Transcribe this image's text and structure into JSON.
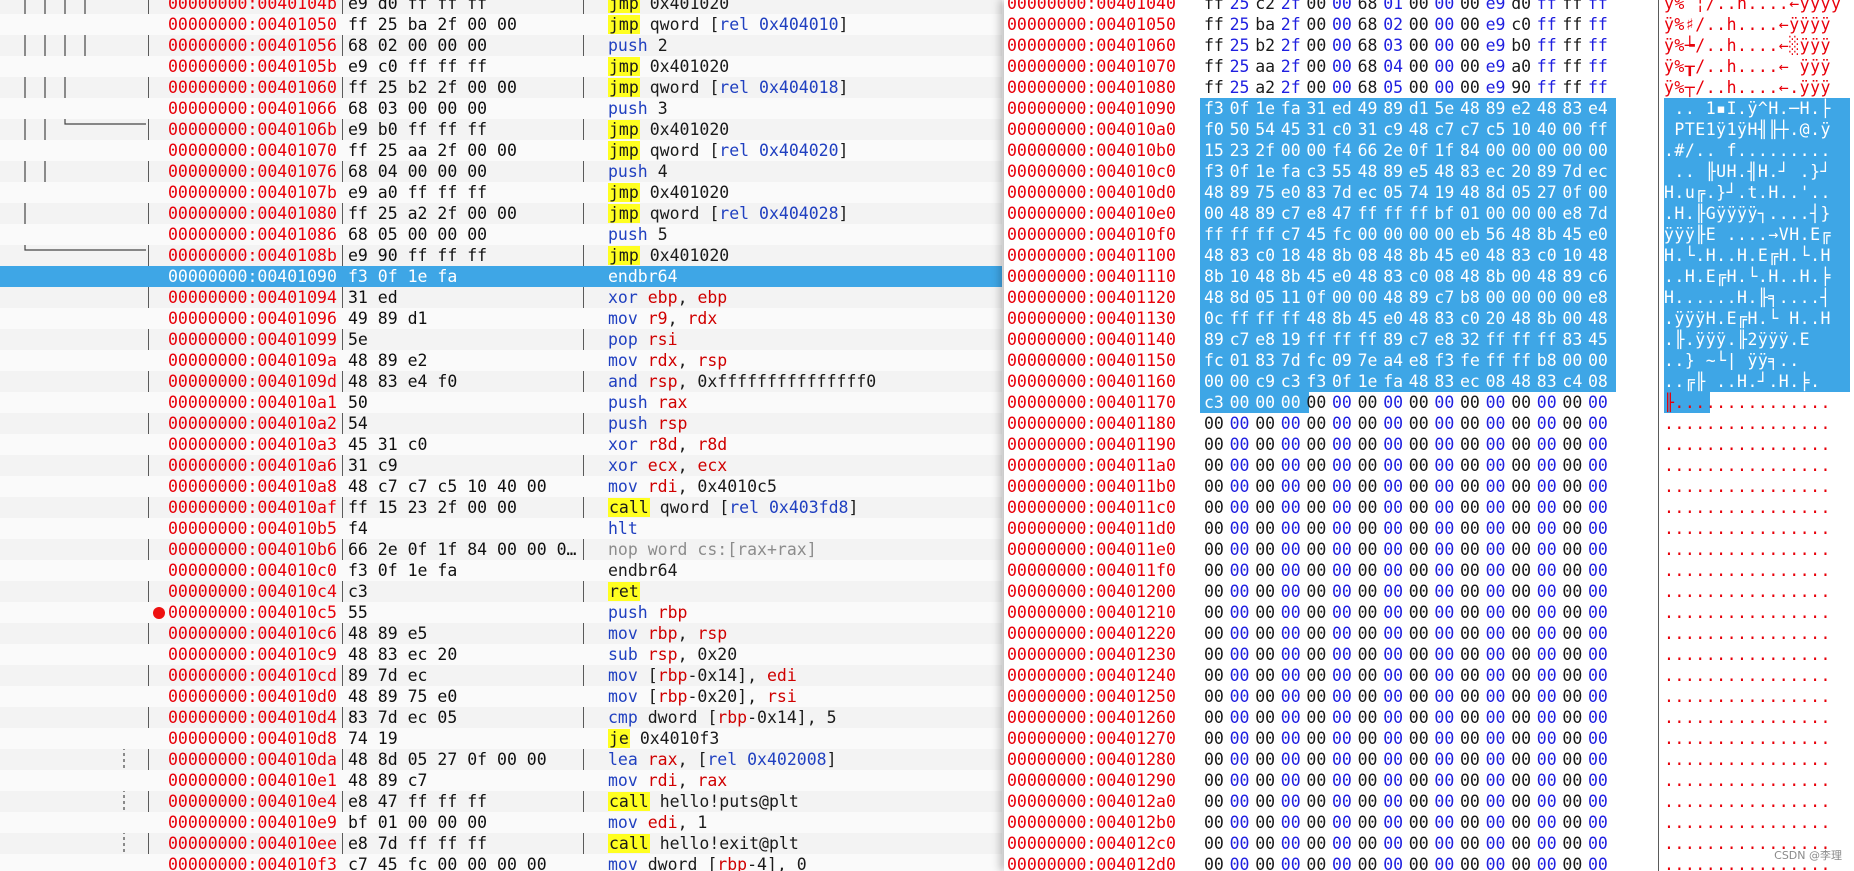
{
  "disassembly": {
    "rows": [
      {
        "addr": "00000000:0040104b",
        "bytes": "e9 d0 ff ff ff",
        "m": "jmp",
        "mk": "jmp",
        "ops": [
          [
            "0x401020",
            "txt"
          ]
        ]
      },
      {
        "addr": "00000000:00401050",
        "bytes": "ff 25 ba 2f 00 00",
        "m": "jmp",
        "mk": "jmp",
        "ops": [
          [
            "qword [",
            "txt"
          ],
          [
            "rel 0x404010",
            "mem"
          ],
          [
            "]",
            "txt"
          ]
        ]
      },
      {
        "addr": "00000000:00401056",
        "bytes": "68 02 00 00 00",
        "m": "push",
        "mk": "blue",
        "ops": [
          [
            "2",
            "txt"
          ]
        ]
      },
      {
        "addr": "00000000:0040105b",
        "bytes": "e9 c0 ff ff ff",
        "m": "jmp",
        "mk": "jmp",
        "ops": [
          [
            "0x401020",
            "txt"
          ]
        ]
      },
      {
        "addr": "00000000:00401060",
        "bytes": "ff 25 b2 2f 00 00",
        "m": "jmp",
        "mk": "jmp",
        "ops": [
          [
            "qword [",
            "txt"
          ],
          [
            "rel 0x404018",
            "mem"
          ],
          [
            "]",
            "txt"
          ]
        ]
      },
      {
        "addr": "00000000:00401066",
        "bytes": "68 03 00 00 00",
        "m": "push",
        "mk": "blue",
        "ops": [
          [
            "3",
            "txt"
          ]
        ]
      },
      {
        "addr": "00000000:0040106b",
        "bytes": "e9 b0 ff ff ff",
        "m": "jmp",
        "mk": "jmp",
        "ops": [
          [
            "0x401020",
            "txt"
          ]
        ]
      },
      {
        "addr": "00000000:00401070",
        "bytes": "ff 25 aa 2f 00 00",
        "m": "jmp",
        "mk": "jmp",
        "ops": [
          [
            "qword [",
            "txt"
          ],
          [
            "rel 0x404020",
            "mem"
          ],
          [
            "]",
            "txt"
          ]
        ]
      },
      {
        "addr": "00000000:00401076",
        "bytes": "68 04 00 00 00",
        "m": "push",
        "mk": "blue",
        "ops": [
          [
            "4",
            "txt"
          ]
        ]
      },
      {
        "addr": "00000000:0040107b",
        "bytes": "e9 a0 ff ff ff",
        "m": "jmp",
        "mk": "jmp",
        "ops": [
          [
            "0x401020",
            "txt"
          ]
        ]
      },
      {
        "addr": "00000000:00401080",
        "bytes": "ff 25 a2 2f 00 00",
        "m": "jmp",
        "mk": "jmp",
        "ops": [
          [
            "qword [",
            "txt"
          ],
          [
            "rel 0x404028",
            "mem"
          ],
          [
            "]",
            "txt"
          ]
        ]
      },
      {
        "addr": "00000000:00401086",
        "bytes": "68 05 00 00 00",
        "m": "push",
        "mk": "blue",
        "ops": [
          [
            "5",
            "txt"
          ]
        ]
      },
      {
        "addr": "00000000:0040108b",
        "bytes": "e9 90 ff ff ff",
        "m": "jmp",
        "mk": "jmp",
        "ops": [
          [
            "0x401020",
            "txt"
          ]
        ]
      },
      {
        "addr": "00000000:00401090",
        "bytes": "f3 0f 1e fa",
        "m": "endbr64",
        "mk": "plain",
        "ops": [],
        "selected": true
      },
      {
        "addr": "00000000:00401094",
        "bytes": "31 ed",
        "m": "xor",
        "mk": "blue",
        "ops": [
          [
            "ebp",
            "reg"
          ],
          [
            ", ",
            "txt"
          ],
          [
            "ebp",
            "reg"
          ]
        ]
      },
      {
        "addr": "00000000:00401096",
        "bytes": "49 89 d1",
        "m": "mov",
        "mk": "blue",
        "ops": [
          [
            "r9",
            "reg"
          ],
          [
            ", ",
            "txt"
          ],
          [
            "rdx",
            "reg"
          ]
        ]
      },
      {
        "addr": "00000000:00401099",
        "bytes": "5e",
        "m": "pop",
        "mk": "blue",
        "ops": [
          [
            "rsi",
            "reg"
          ]
        ]
      },
      {
        "addr": "00000000:0040109a",
        "bytes": "48 89 e2",
        "m": "mov",
        "mk": "blue",
        "ops": [
          [
            "rdx",
            "reg"
          ],
          [
            ", ",
            "txt"
          ],
          [
            "rsp",
            "reg"
          ]
        ]
      },
      {
        "addr": "00000000:0040109d",
        "bytes": "48 83 e4 f0",
        "m": "and",
        "mk": "blue",
        "ops": [
          [
            "rsp",
            "reg"
          ],
          [
            ", 0xfffffffffffffff0",
            "txt"
          ]
        ]
      },
      {
        "addr": "00000000:004010a1",
        "bytes": "50",
        "m": "push",
        "mk": "blue",
        "ops": [
          [
            "rax",
            "reg"
          ]
        ]
      },
      {
        "addr": "00000000:004010a2",
        "bytes": "54",
        "m": "push",
        "mk": "blue",
        "ops": [
          [
            "rsp",
            "reg"
          ]
        ]
      },
      {
        "addr": "00000000:004010a3",
        "bytes": "45 31 c0",
        "m": "xor",
        "mk": "blue",
        "ops": [
          [
            "r8d",
            "reg"
          ],
          [
            ", ",
            "txt"
          ],
          [
            "r8d",
            "reg"
          ]
        ]
      },
      {
        "addr": "00000000:004010a6",
        "bytes": "31 c9",
        "m": "xor",
        "mk": "blue",
        "ops": [
          [
            "ecx",
            "reg"
          ],
          [
            ", ",
            "txt"
          ],
          [
            "ecx",
            "reg"
          ]
        ]
      },
      {
        "addr": "00000000:004010a8",
        "bytes": "48 c7 c7 c5 10 40 00",
        "m": "mov",
        "mk": "blue",
        "ops": [
          [
            "rdi",
            "reg"
          ],
          [
            ", 0x4010c5",
            "txt"
          ]
        ]
      },
      {
        "addr": "00000000:004010af",
        "bytes": "ff 15 23 2f 00 00",
        "m": "call",
        "mk": "hl",
        "ops": [
          [
            "qword [",
            "txt"
          ],
          [
            "rel 0x403fd8",
            "mem"
          ],
          [
            "]",
            "txt"
          ]
        ]
      },
      {
        "addr": "00000000:004010b5",
        "bytes": "f4",
        "m": "hlt",
        "mk": "blue",
        "ops": []
      },
      {
        "addr": "00000000:004010b6",
        "bytes": "66 2e 0f 1f 84 00 00 0…",
        "m": "nop",
        "mk": "nop",
        "ops": [
          [
            "word cs:[rax+rax]",
            "nop"
          ]
        ]
      },
      {
        "addr": "00000000:004010c0",
        "bytes": "f3 0f 1e fa",
        "m": "endbr64",
        "mk": "plain",
        "ops": []
      },
      {
        "addr": "00000000:004010c4",
        "bytes": "c3",
        "m": "ret",
        "mk": "ret",
        "ops": []
      },
      {
        "addr": "00000000:004010c5",
        "bytes": "55",
        "m": "push",
        "mk": "blue",
        "ops": [
          [
            "rbp",
            "reg"
          ]
        ],
        "breakpoint": true
      },
      {
        "addr": "00000000:004010c6",
        "bytes": "48 89 e5",
        "m": "mov",
        "mk": "blue",
        "ops": [
          [
            "rbp",
            "reg"
          ],
          [
            ", ",
            "txt"
          ],
          [
            "rsp",
            "reg"
          ]
        ]
      },
      {
        "addr": "00000000:004010c9",
        "bytes": "48 83 ec 20",
        "m": "sub",
        "mk": "blue",
        "ops": [
          [
            "rsp",
            "reg"
          ],
          [
            ", 0x20",
            "txt"
          ]
        ]
      },
      {
        "addr": "00000000:004010cd",
        "bytes": "89 7d ec",
        "m": "mov",
        "mk": "blue",
        "ops": [
          [
            "[",
            "txt"
          ],
          [
            "rbp",
            "reg"
          ],
          [
            "-0x14], ",
            "txt"
          ],
          [
            "edi",
            "reg"
          ]
        ]
      },
      {
        "addr": "00000000:004010d0",
        "bytes": "48 89 75 e0",
        "m": "mov",
        "mk": "blue",
        "ops": [
          [
            "[",
            "txt"
          ],
          [
            "rbp",
            "reg"
          ],
          [
            "-0x20], ",
            "txt"
          ],
          [
            "rsi",
            "reg"
          ]
        ]
      },
      {
        "addr": "00000000:004010d4",
        "bytes": "83 7d ec 05",
        "m": "cmp",
        "mk": "blue",
        "ops": [
          [
            "dword [",
            "txt"
          ],
          [
            "rbp",
            "reg"
          ],
          [
            "-0x14], 5",
            "txt"
          ]
        ]
      },
      {
        "addr": "00000000:004010d8",
        "bytes": "74 19",
        "m": "je",
        "mk": "jmp",
        "ops": [
          [
            "0x4010f3",
            "txt"
          ]
        ]
      },
      {
        "addr": "00000000:004010da",
        "bytes": "48 8d 05 27 0f 00 00",
        "m": "lea",
        "mk": "blue",
        "ops": [
          [
            "rax",
            "reg"
          ],
          [
            ", [",
            "txt"
          ],
          [
            "rel 0x402008",
            "mem"
          ],
          [
            "]",
            "txt"
          ]
        ]
      },
      {
        "addr": "00000000:004010e1",
        "bytes": "48 89 c7",
        "m": "mov",
        "mk": "blue",
        "ops": [
          [
            "rdi",
            "reg"
          ],
          [
            ", ",
            "txt"
          ],
          [
            "rax",
            "reg"
          ]
        ]
      },
      {
        "addr": "00000000:004010e4",
        "bytes": "e8 47 ff ff ff",
        "m": "call",
        "mk": "hl",
        "ops": [
          [
            "hello!puts@plt",
            "txt"
          ]
        ]
      },
      {
        "addr": "00000000:004010e9",
        "bytes": "bf 01 00 00 00",
        "m": "mov",
        "mk": "blue",
        "ops": [
          [
            "edi",
            "reg"
          ],
          [
            ", 1",
            "txt"
          ]
        ]
      },
      {
        "addr": "00000000:004010ee",
        "bytes": "e8 7d ff ff ff",
        "m": "call",
        "mk": "hl",
        "ops": [
          [
            "hello!exit@plt",
            "txt"
          ]
        ]
      },
      {
        "addr": "00000000:004010f3",
        "bytes": "c7 45 fc 00 00 00 00",
        "m": "mov",
        "mk": "blue",
        "ops": [
          [
            "dword [",
            "txt"
          ],
          [
            "rbp",
            "reg"
          ],
          [
            "-4], 0",
            "txt"
          ]
        ]
      }
    ]
  },
  "hexview": {
    "rows": [
      {
        "addr": "00000000:00401040",
        "bytes": "ff 25 c2 2f 00 00 68 01 00 00 00 e9 d0 ff ff ff",
        "ascii": "ÿ% ¦/..h....←ÿÿÿÿ"
      },
      {
        "addr": "00000000:00401050",
        "bytes": "ff 25 ba 2f 00 00 68 02 00 00 00 e9 c0 ff ff ff",
        "ascii": "ÿ%♯/..h....←ÿÿÿÿ"
      },
      {
        "addr": "00000000:00401060",
        "bytes": "ff 25 b2 2f 00 00 68 03 00 00 00 e9 b0 ff ff ff",
        "ascii": "ÿ%┶/..h....←░ÿÿÿ"
      },
      {
        "addr": "00000000:00401070",
        "bytes": "ff 25 aa 2f 00 00 68 04 00 00 00 e9 a0 ff ff ff",
        "ascii": "ÿ%┰/..h....← ÿÿÿ"
      },
      {
        "addr": "00000000:00401080",
        "bytes": "ff 25 a2 2f 00 00 68 05 00 00 00 e9 90 ff ff ff",
        "ascii": "ÿ%┬/..h....←.ÿÿÿ"
      },
      {
        "addr": "00000000:00401090",
        "bytes": "f3 0f 1e fa 31 ed 49 89 d1 5e 48 89 e2 48 83 e4",
        "ascii": " .. 1▪I.ÿ^H.─H.├",
        "selFrom": 0
      },
      {
        "addr": "00000000:004010a0",
        "bytes": "f0 50 54 45 31 c0 31 c9 48 c7 c7 c5 10 40 00 ff",
        "ascii": " PTE1ÿ1ÿH╢╟┼.@.ÿ",
        "selAll": true
      },
      {
        "addr": "00000000:004010b0",
        "bytes": "15 23 2f 00 00 f4 66 2e 0f 1f 84 00 00 00 00 00",
        "ascii": ".#/.. f.........",
        "selAll": true
      },
      {
        "addr": "00000000:004010c0",
        "bytes": "f3 0f 1e fa c3 55 48 89 e5 48 83 ec 20 89 7d ec",
        "ascii": " .. ╟UH.╢H.┘ .}┘",
        "selAll": true
      },
      {
        "addr": "00000000:004010d0",
        "bytes": "48 89 75 e0 83 7d ec 05 74 19 48 8d 05 27 0f 00",
        "ascii": "H.u╔.}┘.t.H..'..",
        "selAll": true
      },
      {
        "addr": "00000000:004010e0",
        "bytes": "00 48 89 c7 e8 47 ff ff ff bf 01 00 00 00 e8 7d",
        "ascii": ".H.╟Gÿÿÿÿ┐....┤}",
        "selAll": true
      },
      {
        "addr": "00000000:004010f0",
        "bytes": "ff ff ff c7 45 fc 00 00 00 00 eb 56 48 8b 45 e0",
        "ascii": "ÿÿÿ╟E ....→VH.E╔",
        "selAll": true
      },
      {
        "addr": "00000000:00401100",
        "bytes": "48 83 c0 18 48 8b 08 48 8b 45 e0 48 83 c0 10 48",
        "ascii": "H.└.H..H.E╔H.└.H",
        "selAll": true
      },
      {
        "addr": "00000000:00401110",
        "bytes": "8b 10 48 8b 45 e0 48 83 c0 08 48 8b 00 48 89 c6",
        "ascii": "..H.E╔H.└.H..H.╞",
        "selAll": true
      },
      {
        "addr": "00000000:00401120",
        "bytes": "48 8d 05 11 0f 00 00 48 89 c7 b8 00 00 00 00 e8",
        "ascii": "H......H.╟╕....┤",
        "selAll": true
      },
      {
        "addr": "00000000:00401130",
        "bytes": "0c ff ff ff 48 8b 45 e0 48 83 c0 20 48 8b 00 48",
        "ascii": ".ÿÿÿH.E╔H.└ H..H",
        "selAll": true
      },
      {
        "addr": "00000000:00401140",
        "bytes": "89 c7 e8 19 ff ff ff 89 c7 e8 32 ff ff ff 83 45",
        "ascii": ".╟.ÿÿÿ.╟2ÿÿÿ.E",
        "selAll": true
      },
      {
        "addr": "00000000:00401150",
        "bytes": "fc 01 83 7d fc 09 7e a4 e8 f3 fe ff ff b8 00 00",
        "ascii": "..} ~└| ÿÿ╕..",
        "selAll": true
      },
      {
        "addr": "00000000:00401160",
        "bytes": "00 00 c9 c3 f3 0f 1e fa 48 83 ec 08 48 83 c4 08",
        "ascii": "..╔╟ ..H.┘.H.╞.",
        "selAll": true
      },
      {
        "addr": "00000000:00401170",
        "bytes": "c3 00 00 00 00 00 00 00 00 00 00 00 00 00 00 00",
        "ascii": "╟...............",
        "selTo": 3
      },
      {
        "addr": "00000000:00401180",
        "bytes": "00 00 00 00 00 00 00 00 00 00 00 00 00 00 00 00",
        "ascii": "................"
      },
      {
        "addr": "00000000:00401190",
        "bytes": "00 00 00 00 00 00 00 00 00 00 00 00 00 00 00 00",
        "ascii": "................"
      },
      {
        "addr": "00000000:004011a0",
        "bytes": "00 00 00 00 00 00 00 00 00 00 00 00 00 00 00 00",
        "ascii": "................"
      },
      {
        "addr": "00000000:004011b0",
        "bytes": "00 00 00 00 00 00 00 00 00 00 00 00 00 00 00 00",
        "ascii": "................"
      },
      {
        "addr": "00000000:004011c0",
        "bytes": "00 00 00 00 00 00 00 00 00 00 00 00 00 00 00 00",
        "ascii": "................"
      },
      {
        "addr": "00000000:004011d0",
        "bytes": "00 00 00 00 00 00 00 00 00 00 00 00 00 00 00 00",
        "ascii": "................"
      },
      {
        "addr": "00000000:004011e0",
        "bytes": "00 00 00 00 00 00 00 00 00 00 00 00 00 00 00 00",
        "ascii": "................"
      },
      {
        "addr": "00000000:004011f0",
        "bytes": "00 00 00 00 00 00 00 00 00 00 00 00 00 00 00 00",
        "ascii": "................"
      },
      {
        "addr": "00000000:00401200",
        "bytes": "00 00 00 00 00 00 00 00 00 00 00 00 00 00 00 00",
        "ascii": "................"
      },
      {
        "addr": "00000000:00401210",
        "bytes": "00 00 00 00 00 00 00 00 00 00 00 00 00 00 00 00",
        "ascii": "................"
      },
      {
        "addr": "00000000:00401220",
        "bytes": "00 00 00 00 00 00 00 00 00 00 00 00 00 00 00 00",
        "ascii": "................"
      },
      {
        "addr": "00000000:00401230",
        "bytes": "00 00 00 00 00 00 00 00 00 00 00 00 00 00 00 00",
        "ascii": "................"
      },
      {
        "addr": "00000000:00401240",
        "bytes": "00 00 00 00 00 00 00 00 00 00 00 00 00 00 00 00",
        "ascii": "................"
      },
      {
        "addr": "00000000:00401250",
        "bytes": "00 00 00 00 00 00 00 00 00 00 00 00 00 00 00 00",
        "ascii": "................"
      },
      {
        "addr": "00000000:00401260",
        "bytes": "00 00 00 00 00 00 00 00 00 00 00 00 00 00 00 00",
        "ascii": "................"
      },
      {
        "addr": "00000000:00401270",
        "bytes": "00 00 00 00 00 00 00 00 00 00 00 00 00 00 00 00",
        "ascii": "................"
      },
      {
        "addr": "00000000:00401280",
        "bytes": "00 00 00 00 00 00 00 00 00 00 00 00 00 00 00 00",
        "ascii": "................"
      },
      {
        "addr": "00000000:00401290",
        "bytes": "00 00 00 00 00 00 00 00 00 00 00 00 00 00 00 00",
        "ascii": "................"
      },
      {
        "addr": "00000000:004012a0",
        "bytes": "00 00 00 00 00 00 00 00 00 00 00 00 00 00 00 00",
        "ascii": "................"
      },
      {
        "addr": "00000000:004012b0",
        "bytes": "00 00 00 00 00 00 00 00 00 00 00 00 00 00 00 00",
        "ascii": "................"
      },
      {
        "addr": "00000000:004012c0",
        "bytes": "00 00 00 00 00 00 00 00 00 00 00 00 00 00 00 00",
        "ascii": "................"
      },
      {
        "addr": "00000000:004012d0",
        "bytes": "00 00 00 00 00 00 00 00 00 00 00 00 00 00 00 00",
        "ascii": "................"
      }
    ]
  },
  "watermark": "CSDN @李理",
  "colors": {
    "address": "#e8000a",
    "selection": "#3ea6e6",
    "mnemonic_hl": "#ffff20",
    "keyword": "#2040c0"
  }
}
